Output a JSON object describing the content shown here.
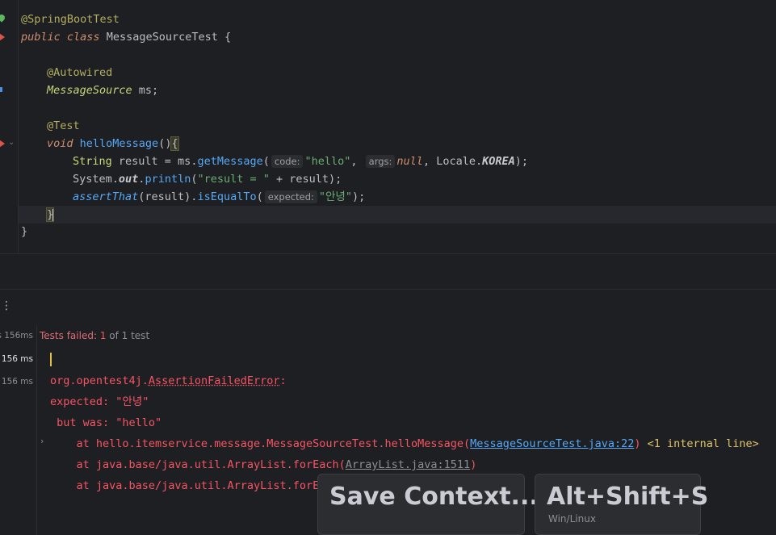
{
  "editor": {
    "lines": {
      "l1_annotation": "@SpringBootTest",
      "l2_public": "public",
      "l2_class": "class",
      "l2_name": "MessageSourceTest",
      "l2_brace": " {",
      "l4_annotation": "@Autowired",
      "l5_type": "MessageSource",
      "l5_var": " ms;",
      "l7_annotation": "@Test",
      "l8_void": "void",
      "l8_method": "helloMessage",
      "l8_parens": "()",
      "l8_brace": "{",
      "l9_type": "String",
      "l9_assign": " result = ms.",
      "l9_call": "getMessage",
      "l9_open": "(",
      "l9_hint_code": "code:",
      "l9_str": "\"hello\"",
      "l9_comma": ",",
      "l9_hint_args": "args:",
      "l9_null": "null",
      "l9_locale": ", Locale.",
      "l9_korea": "KOREA",
      "l9_end": ");",
      "l10_system": "System.",
      "l10_out": "out",
      "l10_dot": ".",
      "l10_println": "println",
      "l10_open": "(",
      "l10_str": "\"result = \"",
      "l10_rest": " + result);",
      "l11_assert": "assertThat",
      "l11_mid": "(result).",
      "l11_equal": "isEqualTo",
      "l11_open": "(",
      "l11_hint": "expected:",
      "l11_str": "\"안녕\"",
      "l11_end": ");",
      "l12_brace": "}",
      "l13_brace": "}"
    }
  },
  "test_panel": {
    "menu_icon": "kebab-menu-icon",
    "tree": [
      {
        "label": "s 156ms"
      },
      {
        "label": "c 156 ms"
      },
      {
        "label": "c 156 ms"
      }
    ],
    "status_prefix": "Tests failed: ",
    "status_failed": "1",
    "status_suffix": " of 1 test",
    "output": {
      "error_pkg": "org.opentest4j.",
      "error_cls": "AssertionFailedError",
      "error_colon": ":",
      "expected": "expected: \"안녕\"",
      "but_was": " but was: \"hello\"",
      "at1_prefix": "    at hello.itemservice.message.MessageSourceTest.helloMessage(",
      "at1_link": "MessageSourceTest.java:22",
      "at1_close": ")",
      "at1_internal": " <1 internal line>",
      "at2_prefix": "    at java.base/java.util.ArrayList.forEach(",
      "at2_link": "ArrayList.java:1511",
      "at2_close": ")",
      "at3_prefix": "    at java.base/java.util.ArrayList.forEa"
    }
  },
  "key_popup": {
    "action_label": "Save Context...",
    "shortcut_label": "Alt+Shift+S",
    "platform_label": "Win/Linux"
  }
}
